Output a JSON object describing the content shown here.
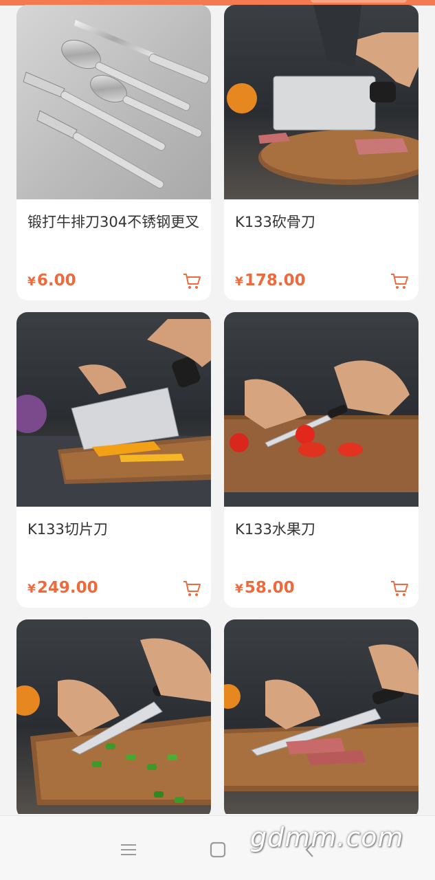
{
  "products": [
    {
      "name": "锻打牛排刀304不锈钢更叉",
      "currency": "¥",
      "price": "6.00",
      "image": "cutlery-set"
    },
    {
      "name": "K133砍骨刀",
      "currency": "¥",
      "price": "178.00",
      "image": "bone-cleaver"
    },
    {
      "name": "K133切片刀",
      "currency": "¥",
      "price": "249.00",
      "image": "slicing-knife"
    },
    {
      "name": "K133水果刀",
      "currency": "¥",
      "price": "58.00",
      "image": "fruit-knife"
    },
    {
      "name": "",
      "image": "chef-knife-peppers"
    },
    {
      "name": "",
      "image": "chef-knife-meat"
    }
  ],
  "icons": {
    "cart": "cart-icon",
    "menu": "menu-icon",
    "home": "home-icon",
    "back": "back-icon"
  },
  "colors": {
    "accent": "#ee6a3c",
    "topbar": "#f47b4f"
  },
  "watermark": "gdmm.com"
}
